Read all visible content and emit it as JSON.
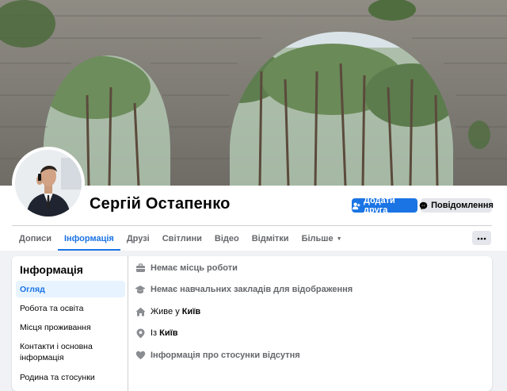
{
  "profile": {
    "name": "Сергій Остапенко",
    "add_friend_label": "Додати друга",
    "message_label": "Повідомлення",
    "more_label": "···"
  },
  "tabs": [
    {
      "label": "Дописи",
      "active": false
    },
    {
      "label": "Інформація",
      "active": true
    },
    {
      "label": "Друзі",
      "active": false
    },
    {
      "label": "Світлини",
      "active": false
    },
    {
      "label": "Відео",
      "active": false
    },
    {
      "label": "Відмітки",
      "active": false
    },
    {
      "label": "Більше",
      "active": false,
      "dropdown": true
    }
  ],
  "about": {
    "title": "Інформація",
    "menu": [
      {
        "label": "Огляд",
        "active": true
      },
      {
        "label": "Робота та освіта",
        "active": false
      },
      {
        "label": "Місця проживання",
        "active": false
      },
      {
        "label": "Контакти і основна інформація",
        "active": false
      },
      {
        "label": "Родина та стосунки",
        "active": false
      }
    ],
    "rows": {
      "work": "Немає місць роботи",
      "education": "Немає навчальних закладів для відображення",
      "lives_prefix": "Живе у",
      "lives_city": "Київ",
      "from_prefix": "Із",
      "from_city": "Київ",
      "relationship": "Інформація про стосунки відсутня"
    }
  },
  "colors": {
    "accent": "#1b74e4",
    "background": "#f0f2f5",
    "muted_text": "#65676b",
    "secondary_button": "#e4e6eb"
  },
  "icons": {
    "add_friend": "person-plus-icon",
    "message": "messenger-icon",
    "more": "ellipsis-icon",
    "work": "briefcase-icon",
    "education": "graduation-cap-icon",
    "lives": "home-icon",
    "from": "location-pin-icon",
    "relationship": "heart-icon"
  }
}
